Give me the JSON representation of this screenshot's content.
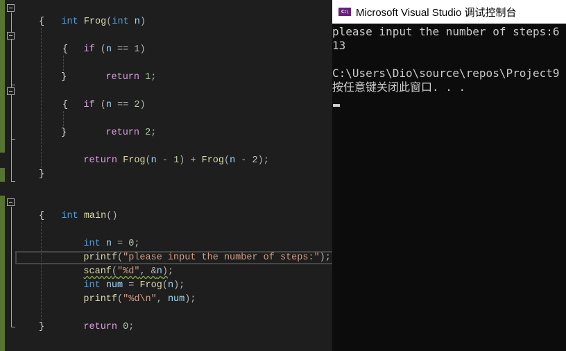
{
  "editor": {
    "lines": {
      "l1": [
        "int",
        " ",
        "Frog",
        "(",
        "int",
        " ",
        "n",
        ")"
      ],
      "l2": [
        "{"
      ],
      "l3": [
        "if",
        " (",
        "n",
        " == ",
        "1",
        ")"
      ],
      "l4": [
        "{"
      ],
      "l5": [
        "return",
        " ",
        "1",
        ";"
      ],
      "l6": [
        "}"
      ],
      "l7": [
        "if",
        " (",
        "n",
        " == ",
        "2",
        ")"
      ],
      "l8": [
        "{"
      ],
      "l9": [
        "return",
        " ",
        "2",
        ";"
      ],
      "l10": [
        "}"
      ],
      "l11": [
        "return",
        " ",
        "Frog",
        "(",
        "n",
        " - ",
        "1",
        ") + ",
        "Frog",
        "(",
        "n",
        " - ",
        "2",
        ");"
      ],
      "l13": [
        "}"
      ],
      "l15": [
        "int",
        " ",
        "main",
        "()"
      ],
      "l16": [
        "{"
      ],
      "l17": [
        "int",
        " ",
        "n",
        " = ",
        "0",
        ";"
      ],
      "l18": [
        "printf",
        "(",
        "\"please input the number of steps:\"",
        ");"
      ],
      "l19": [
        "scanf",
        "(",
        "\"%d\"",
        ", &",
        "n",
        ")",
        ";"
      ],
      "l20": [
        "int",
        " ",
        "num",
        " = ",
        "Frog",
        "(",
        "n",
        ");"
      ],
      "l21": [
        "printf",
        "(",
        "\"%d\\n\"",
        ", ",
        "num",
        ");"
      ],
      "l23": [
        "return",
        " ",
        "0",
        ";"
      ],
      "l24": [
        "}"
      ]
    }
  },
  "console": {
    "title": "Microsoft Visual Studio 调试控制台",
    "icon": "vs-debug-console-icon",
    "icon_label": "C:\\",
    "output": [
      "please input the number of steps:6",
      "13",
      "",
      "C:\\Users\\Dio\\source\\repos\\Project9",
      "按任意键关闭此窗口. . ."
    ]
  },
  "colors": {
    "editor_bg": "#1e1e1e",
    "console_bg": "#0c0c0c",
    "change_bar": "#577430",
    "keyword": "#569cd6",
    "control": "#d8a0df",
    "function": "#dcdcaa",
    "string": "#d69d85"
  }
}
